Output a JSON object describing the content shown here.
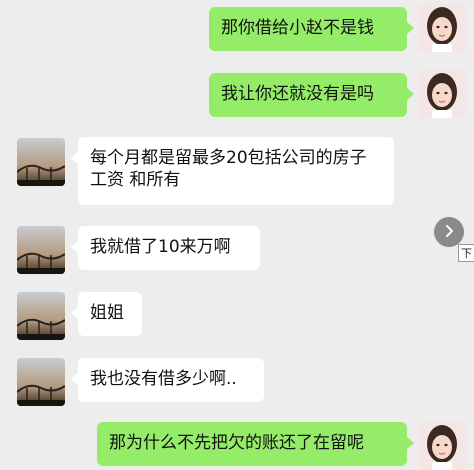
{
  "messages": [
    {
      "text": "那你借给小赵不是钱",
      "side": "sent"
    },
    {
      "text": "我让你还就没有是吗",
      "side": "sent"
    },
    {
      "text": "每个月都是留最多20包括公司的房子 工资 和所有",
      "side": "received"
    },
    {
      "text": "我就借了10来万啊",
      "side": "received"
    },
    {
      "text": "姐姐",
      "side": "received"
    },
    {
      "text": "我也没有借多少啊..",
      "side": "received"
    },
    {
      "text": "那为什么不先把欠的账还了在留呢",
      "side": "sent"
    }
  ],
  "icons": {
    "scroll": "chevron-right-icon",
    "sender_avatar": "avatar-girl",
    "receiver_avatar": "avatar-sunset-rollercoaster"
  },
  "tooltip": {
    "label": "下"
  },
  "colors": {
    "background": "#ededed",
    "sent_bubble": "#95ec69",
    "received_bubble": "#ffffff"
  }
}
